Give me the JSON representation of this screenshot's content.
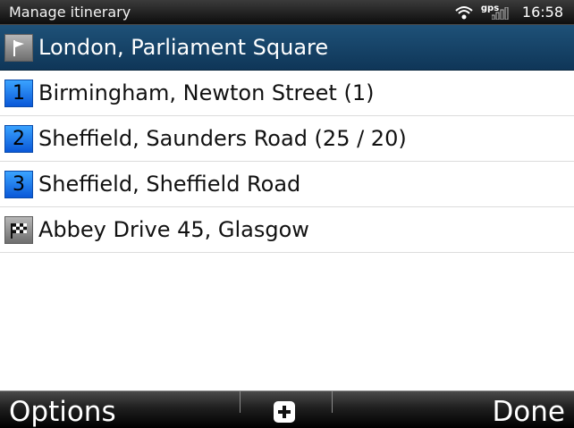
{
  "status": {
    "title": "Manage itinerary",
    "gps_label": "gps",
    "time": "16:58"
  },
  "itinerary": {
    "items": [
      {
        "marker": "",
        "marker_icon": "start-flag-icon",
        "label": "London, Parliament Square",
        "selected": true
      },
      {
        "marker": "1",
        "marker_icon": "waypoint-number-badge",
        "label": "Birmingham, Newton Street (1)",
        "selected": false
      },
      {
        "marker": "2",
        "marker_icon": "waypoint-number-badge",
        "label": "Sheffield, Saunders Road (25 / 20)",
        "selected": false
      },
      {
        "marker": "3",
        "marker_icon": "waypoint-number-badge",
        "label": "Sheffield, Sheffield Road",
        "selected": false
      },
      {
        "marker": "",
        "marker_icon": "finish-checkered-flag-icon",
        "label": "Abbey Drive 45, Glasgow",
        "selected": false
      }
    ]
  },
  "softkeys": {
    "left": "Options",
    "center_icon": "plus-icon",
    "right": "Done"
  },
  "colors": {
    "selected_row": "#1e5178",
    "badge_blue": "#0a58d8",
    "badge_gray": "#8c8c8c",
    "bar_dark": "#1a1a1a"
  }
}
